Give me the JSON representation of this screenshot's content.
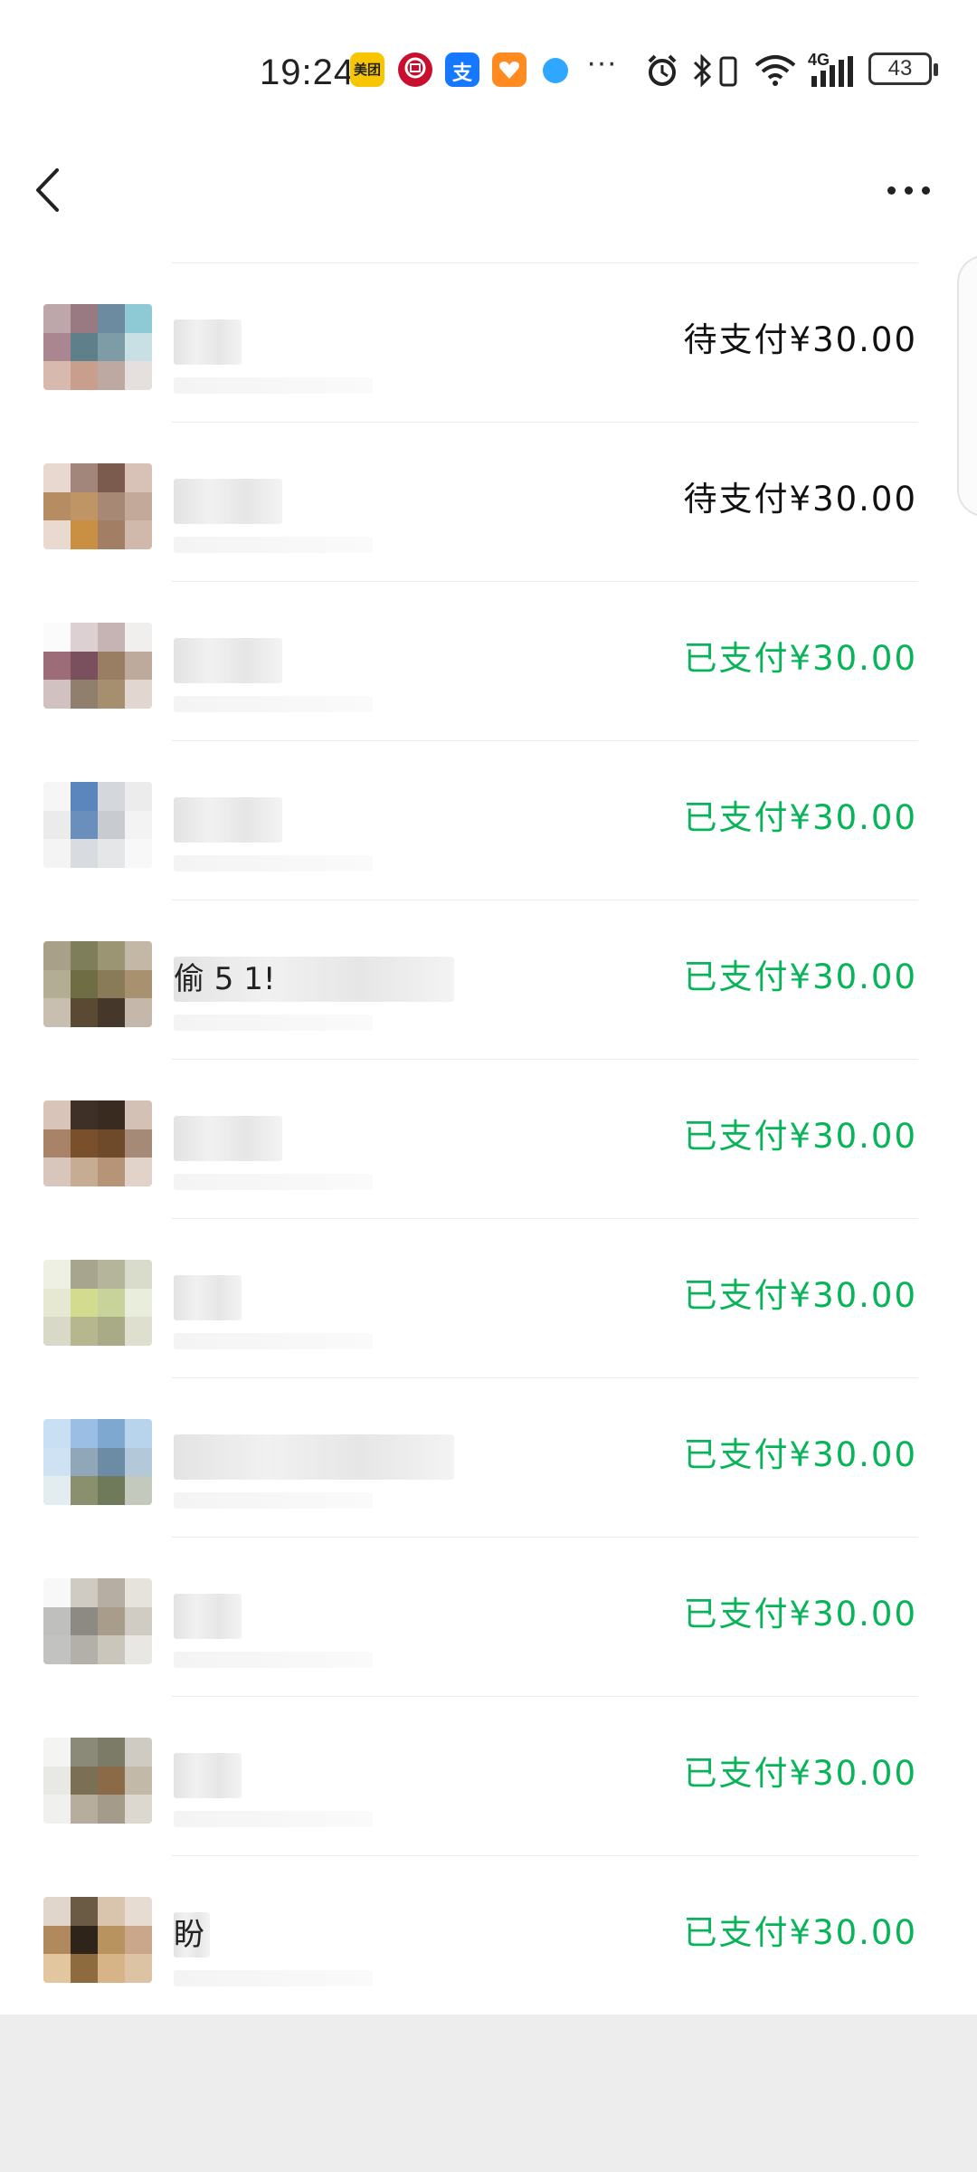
{
  "status_bar": {
    "time": "19:24",
    "app_icons": [
      "meituan-app-icon",
      "bank-of-china-app-icon",
      "alipay-app-icon",
      "health-app-icon",
      "browser-app-icon"
    ],
    "meituan_glyph": "美团",
    "alipay_glyph": "支",
    "more": "···",
    "network": "4G",
    "battery": "43"
  },
  "header": {
    "back_icon": "chevron-left-icon",
    "more_icon": "more-dots-icon"
  },
  "orders": [
    {
      "name": "",
      "status": "待支付¥30.00",
      "paid": false,
      "avatar_colors": [
        "#bda7aa",
        "#9a7a82",
        "#6c8aa0",
        "#8ec9d6",
        "#aa8790",
        "#5f7f8b",
        "#7d9ca6",
        "#c8dfe3",
        "#d7b9ad",
        "#c89e8d",
        "#bda8a2",
        "#e5e0dd"
      ],
      "name_w": 75
    },
    {
      "name": "",
      "status": "待支付¥30.00",
      "paid": false,
      "avatar_colors": [
        "#e9d8d0",
        "#a3867b",
        "#7b5b4e",
        "#d8c2b7",
        "#b68d62",
        "#bf9566",
        "#a78874",
        "#c2a99a",
        "#ead9cf",
        "#c98f42",
        "#a27f64",
        "#d0b9ab"
      ],
      "name_w": 120
    },
    {
      "name": "",
      "status": "已支付¥30.00",
      "paid": true,
      "avatar_colors": [
        "#fbfbfb",
        "#ddd0d3",
        "#c6b3b4",
        "#f1eeee",
        "#9d6c79",
        "#7a4f5e",
        "#9a7e64",
        "#bea99d",
        "#d1c2c1",
        "#8f7f6c",
        "#a68f6f",
        "#e2d6d0"
      ],
      "name_w": 120
    },
    {
      "name": "",
      "status": "已支付¥30.00",
      "paid": true,
      "avatar_colors": [
        "#f6f6f6",
        "#5a86bd",
        "#d4d8dd",
        "#ececec",
        "#ebebeb",
        "#6b8fbc",
        "#c8ccd0",
        "#f3f3f3",
        "#f4f4f4",
        "#d8dbe0",
        "#e4e6e8",
        "#f8f8f8"
      ],
      "name_w": 120
    },
    {
      "name": "偷 5 1!",
      "status": "已支付¥30.00",
      "paid": true,
      "avatar_colors": [
        "#a9a08a",
        "#7f7e5a",
        "#9c9574",
        "#c2b8a5",
        "#b3ad94",
        "#6f6d43",
        "#8a7b58",
        "#a8916f",
        "#c9bfb1",
        "#5b4a33",
        "#45382a",
        "#c4b8ab"
      ],
      "name_w": 310
    },
    {
      "name": "",
      "status": "已支付¥30.00",
      "paid": true,
      "avatar_colors": [
        "#d8c4b9",
        "#3f3027",
        "#3a2b20",
        "#d3c1b6",
        "#a98368",
        "#7a4f2c",
        "#6e4a2b",
        "#a58a78",
        "#d8c5bb",
        "#c7ac94",
        "#b59478",
        "#e1d3ca"
      ],
      "name_w": 120
    },
    {
      "name": "",
      "status": "已支付¥30.00",
      "paid": true,
      "avatar_colors": [
        "#eef0e3",
        "#a7a58e",
        "#b4b59b",
        "#d9dccb",
        "#e6e8d2",
        "#d3db8e",
        "#c8d29b",
        "#e8eddc",
        "#d8d9c6",
        "#b6b78e",
        "#a8ab86",
        "#dedfcf"
      ],
      "name_w": 75
    },
    {
      "name": "",
      "status": "已支付¥30.00",
      "paid": true,
      "avatar_colors": [
        "#c9dff3",
        "#9bbfe4",
        "#7fa8d0",
        "#b8d3ec",
        "#cfe2f4",
        "#8fa7b8",
        "#6b8ca4",
        "#b3c9d9",
        "#e3ecef",
        "#8a8f6d",
        "#6f7a5b",
        "#c3c9bc"
      ],
      "name_w": 310
    },
    {
      "name": "",
      "status": "已支付¥30.00",
      "paid": true,
      "avatar_colors": [
        "#f8f8f8",
        "#cfcac2",
        "#b7aea3",
        "#e6e2dc",
        "#bfbfbd",
        "#8d8a84",
        "#a79d8a",
        "#d0ccc4",
        "#c2c2c0",
        "#b3b0aa",
        "#cbc6bc",
        "#e9e7e3"
      ],
      "name_w": 75
    },
    {
      "name": "",
      "status": "已支付¥30.00",
      "paid": true,
      "avatar_colors": [
        "#f4f4f2",
        "#8b8a78",
        "#7c7b67",
        "#cfcbc3",
        "#e8e8e4",
        "#7b6f55",
        "#8b6a48",
        "#c2b9a8",
        "#f0f0ee",
        "#b7ad9c",
        "#a49b8b",
        "#dcd8d0"
      ],
      "name_w": 75
    },
    {
      "name": "盼",
      "status": "已支付¥30.00",
      "paid": true,
      "avatar_colors": [
        "#e0d6cb",
        "#6b5b45",
        "#d9c5ad",
        "#e7dcd1",
        "#b08a5c",
        "#2e241a",
        "#b9935f",
        "#caa78a",
        "#e2c6a0",
        "#8e6a3f",
        "#d7b487",
        "#dcc3a4"
      ],
      "name_w": 40
    }
  ]
}
